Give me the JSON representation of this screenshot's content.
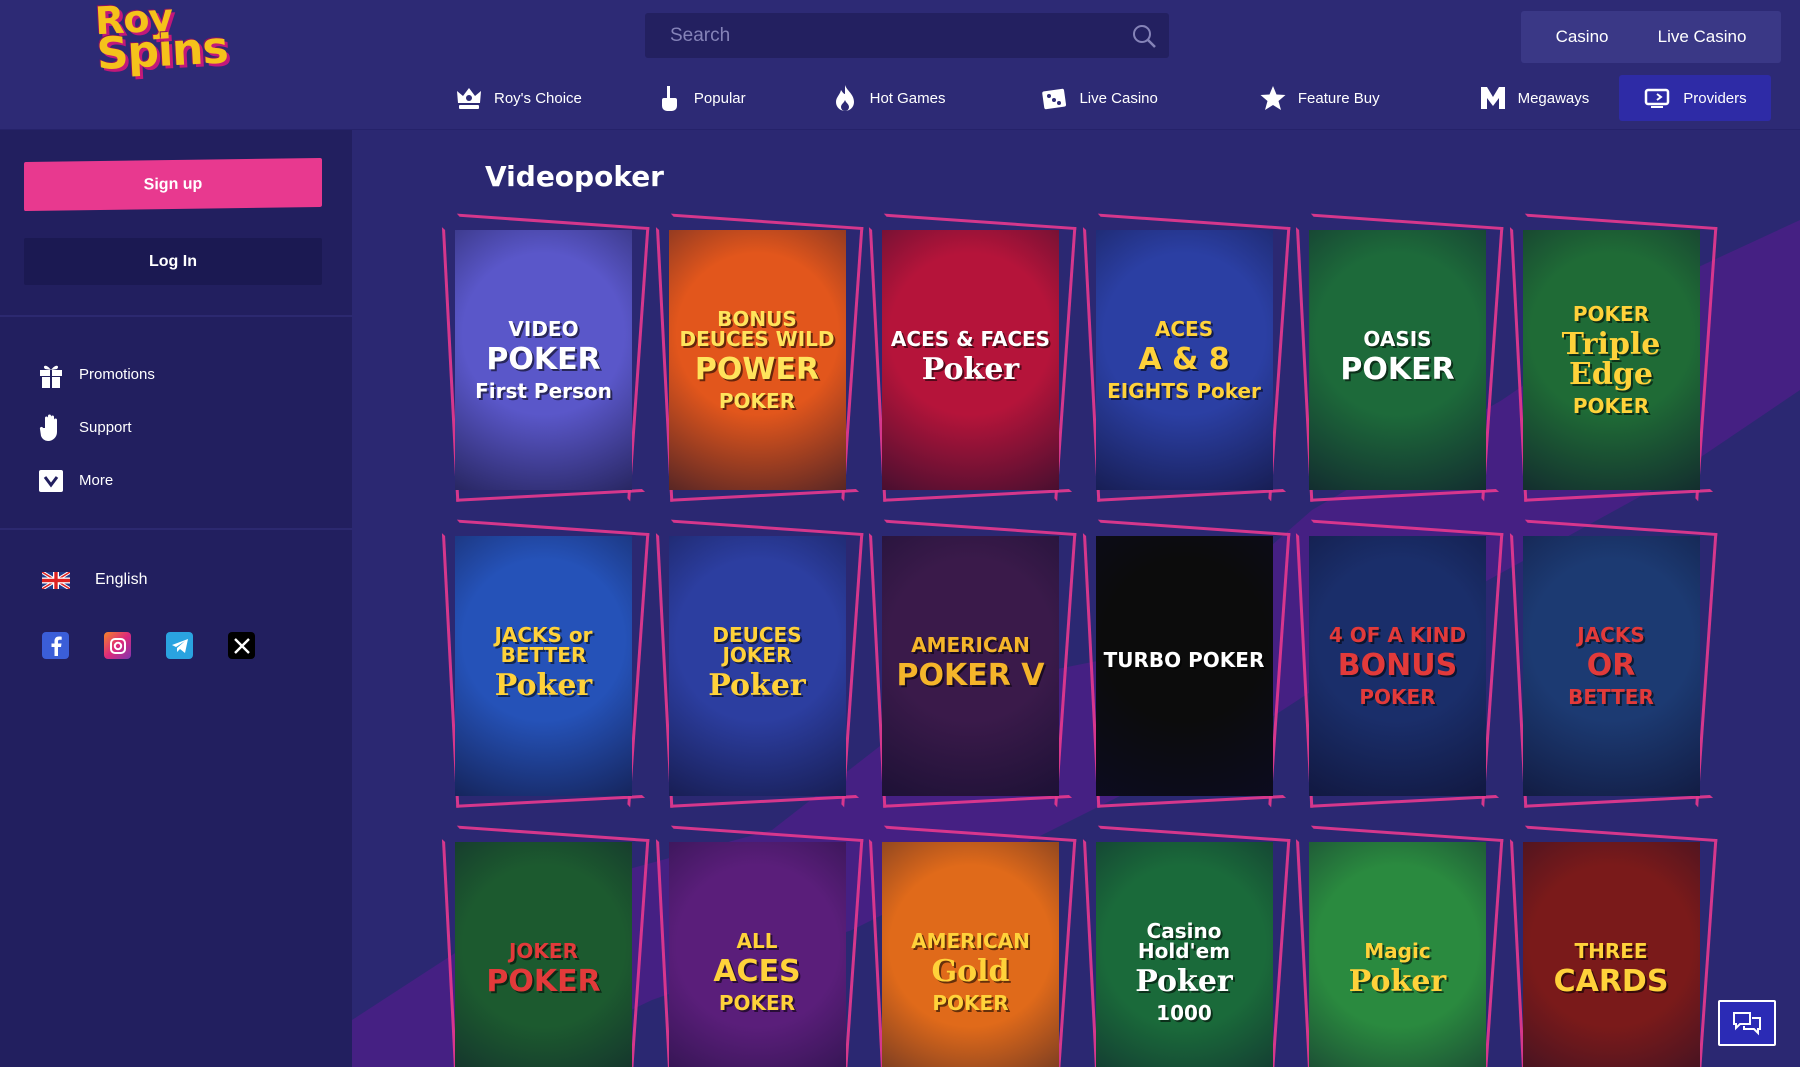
{
  "brand": {
    "logo_line1": "Roy",
    "logo_line2": "Spins"
  },
  "search": {
    "placeholder": "Search"
  },
  "top_tabs": [
    "Casino",
    "Live Casino"
  ],
  "nav": [
    {
      "label": "Roy's Choice",
      "icon": "crown-icon"
    },
    {
      "label": "Popular",
      "icon": "hand-pointer-icon"
    },
    {
      "label": "Hot Games",
      "icon": "flame-icon"
    },
    {
      "label": "Live Casino",
      "icon": "dice-icon"
    },
    {
      "label": "Feature Buy",
      "icon": "star-icon"
    },
    {
      "label": "Megaways",
      "icon": "m-icon"
    },
    {
      "label": "Providers",
      "icon": "providers-icon",
      "active": true
    }
  ],
  "sidebar": {
    "signup_label": "Sign up",
    "login_label": "Log In",
    "items": [
      {
        "label": "Promotions",
        "icon": "gift-icon"
      },
      {
        "label": "Support",
        "icon": "hand-icon"
      },
      {
        "label": "More",
        "icon": "chevron-down-icon"
      }
    ],
    "language": "English",
    "socials": [
      "facebook-icon",
      "instagram-icon",
      "telegram-icon",
      "x-icon"
    ]
  },
  "page": {
    "title": "Videopoker"
  },
  "games": [
    {
      "l1": "VIDEO",
      "l2": "POKER",
      "l3": "First Person",
      "bg": "#5a57c9",
      "fg": "#ffffff"
    },
    {
      "l1": "BONUS DEUCES WILD",
      "l2": "POWER",
      "l3": "POKER",
      "bg": "#e2561c",
      "fg": "#ffe45c"
    },
    {
      "l1": "ACES & FACES",
      "l2": "Poker",
      "l3": "",
      "bg": "#b5143a",
      "fg": "#ffffff"
    },
    {
      "l1": "ACES",
      "l2": "A & 8",
      "l3": "EIGHTS Poker",
      "bg": "#2b3fa3",
      "fg": "#ffd23a"
    },
    {
      "l1": "OASIS",
      "l2": "POKER",
      "l3": "",
      "bg": "#1d6a3a",
      "fg": "#ffffff"
    },
    {
      "l1": "POKER",
      "l2": "Triple Edge",
      "l3": "POKER",
      "bg": "#1f6b36",
      "fg": "#ffd23a"
    },
    {
      "l1": "JACKS or BETTER",
      "l2": "Poker",
      "l3": "",
      "bg": "#2552b8",
      "fg": "#ffd23a"
    },
    {
      "l1": "DEUCES JOKER",
      "l2": "Poker",
      "l3": "",
      "bg": "#2c3ea0",
      "fg": "#ffd23a"
    },
    {
      "l1": "AMERICAN",
      "l2": "POKER V",
      "l3": "",
      "bg": "#3a1a4a",
      "fg": "#f5b52a"
    },
    {
      "l1": "TURBO POKER",
      "l2": "",
      "l3": "",
      "bg": "#0c0c0c",
      "fg": "#ffffff"
    },
    {
      "l1": "4 OF A KIND",
      "l2": "BONUS",
      "l3": "POKER",
      "bg": "#1a2e6a",
      "fg": "#e23a3a"
    },
    {
      "l1": "JACKS",
      "l2": "OR",
      "l3": "BETTER",
      "bg": "#1c3a72",
      "fg": "#e23a3a"
    },
    {
      "l1": "JOKER",
      "l2": "POKER",
      "l3": "",
      "bg": "#1c5a2f",
      "fg": "#e23a3a"
    },
    {
      "l1": "ALL",
      "l2": "ACES",
      "l3": "POKER",
      "bg": "#5a1e7a",
      "fg": "#ffd23a"
    },
    {
      "l1": "AMERICAN",
      "l2": "Gold",
      "l3": "POKER",
      "bg": "#e06a1a",
      "fg": "#ffd23a"
    },
    {
      "l1": "Casino Hold'em",
      "l2": "Poker",
      "l3": "1000",
      "bg": "#1a6a3a",
      "fg": "#ffffff"
    },
    {
      "l1": "Magic",
      "l2": "Poker",
      "l3": "",
      "bg": "#2a8a3f",
      "fg": "#ffd23a"
    },
    {
      "l1": "THREE",
      "l2": "CARDS",
      "l3": "",
      "bg": "#7a1a1a",
      "fg": "#ffd23a"
    }
  ],
  "colors": {
    "accent": "#e8398f",
    "bg": "#2a2770",
    "sidebar": "#221f5f",
    "active_nav": "#2e2ba6"
  }
}
